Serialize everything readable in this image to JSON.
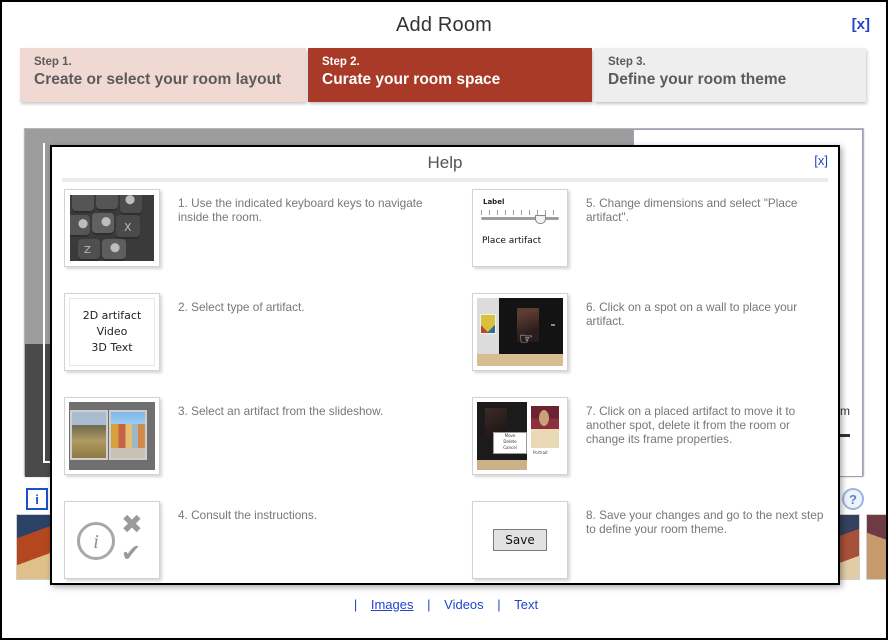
{
  "window": {
    "title": "Add Room",
    "close_label": "[x]"
  },
  "steps": [
    {
      "num": "Step 1.",
      "label": "Create or select your room layout",
      "state": "done"
    },
    {
      "num": "Step 2.",
      "label": "Curate your room space",
      "state": "active"
    },
    {
      "num": "Step 3.",
      "label": "Define your room theme",
      "state": "upcoming"
    }
  ],
  "editor": {
    "unit_label": "cm",
    "info_button_label": "i",
    "help_button_label": "?"
  },
  "help": {
    "title": "Help",
    "close_label": "[x]",
    "items": [
      {
        "text": "1. Use the indicated keyboard keys to navigate inside the room.",
        "thumb": "keyboard-keys"
      },
      {
        "text": "5. Change dimensions and select \"Place artifact\".",
        "thumb": "place-artifact-panel"
      },
      {
        "text": "2. Select type of artifact.",
        "thumb": "artifact-types"
      },
      {
        "text": "6. Click on a spot on a wall to place your artifact.",
        "thumb": "gallery-room-click"
      },
      {
        "text": "3. Select an artifact from the slideshow.",
        "thumb": "slideshow"
      },
      {
        "text": "7. Click on a placed artifact to move it to another spot, delete it from the room or change its frame properties.",
        "thumb": "placed-artifact-menu"
      },
      {
        "text": "4. Consult the instructions.",
        "thumb": "instruction-icons"
      },
      {
        "text": "8. Save your changes and go to the next step to define your room theme.",
        "thumb": "save-button"
      }
    ],
    "thumb_labels": {
      "artifact_types": [
        "2D artifact",
        "Video",
        "3D Text"
      ],
      "place_panel_label": "Label",
      "place_panel_button": "Place artifact",
      "context_menu": [
        "Move",
        "Delete",
        "Cancel"
      ],
      "portrait_caption": "Portrait",
      "save_label": "Save",
      "key_glyphs": [
        "▲",
        "▼",
        "◀",
        "▶",
        "X",
        "Z"
      ]
    }
  },
  "footer": {
    "sep": "|",
    "links": [
      {
        "label": "Images",
        "active": true
      },
      {
        "label": "Videos",
        "active": false
      },
      {
        "label": "Text",
        "active": false
      }
    ]
  },
  "colors": {
    "step_active_bg": "#a83a27",
    "step_done_bg": "#f0d9d3",
    "step_upcoming_bg": "#eeeeee",
    "link": "#2244cc"
  }
}
